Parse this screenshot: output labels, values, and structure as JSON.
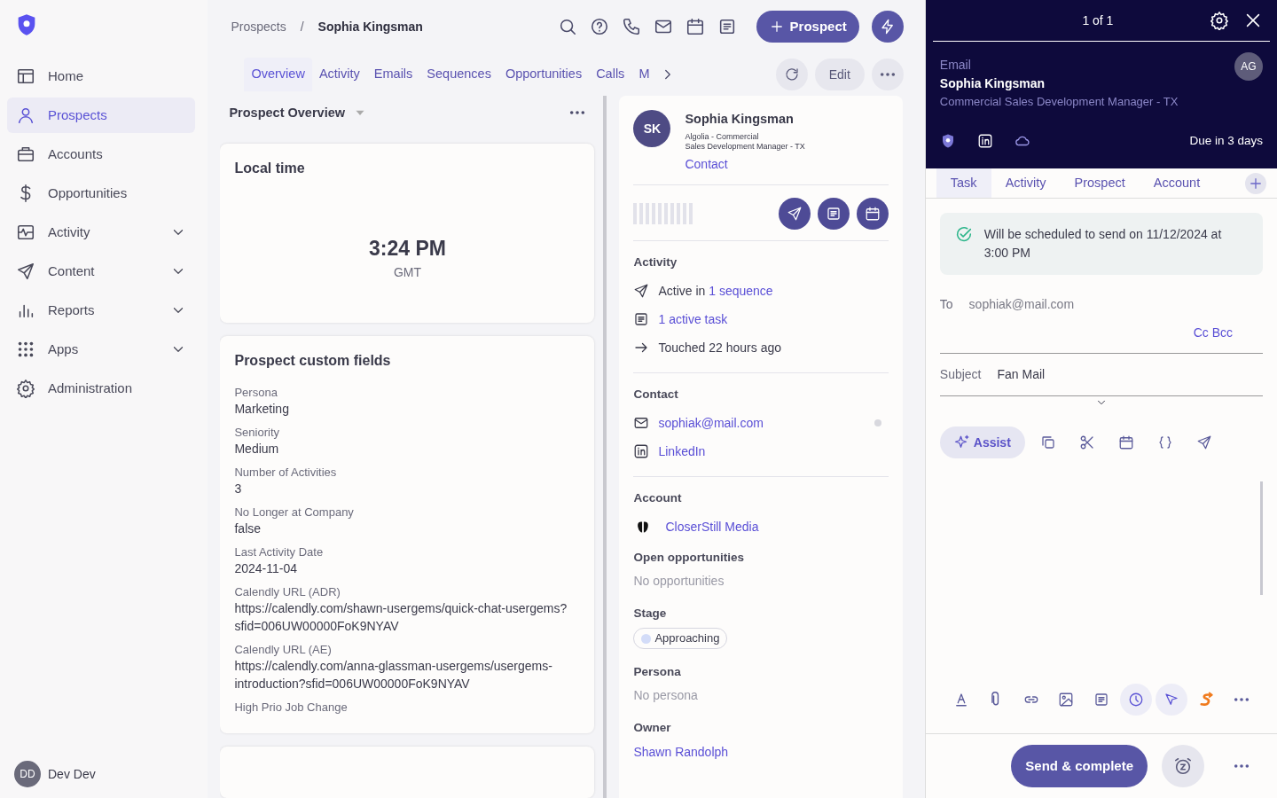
{
  "sidebar": {
    "items": [
      {
        "label": "Home",
        "kind": "link",
        "selected": false
      },
      {
        "label": "Prospects",
        "kind": "link",
        "selected": true
      },
      {
        "label": "Accounts",
        "kind": "link",
        "selected": false
      },
      {
        "label": "Opportunities",
        "kind": "link",
        "selected": false
      },
      {
        "label": "Activity",
        "kind": "group",
        "selected": false
      },
      {
        "label": "Content",
        "kind": "group",
        "selected": false
      },
      {
        "label": "Reports",
        "kind": "group",
        "selected": false
      },
      {
        "label": "Apps",
        "kind": "group",
        "selected": false
      },
      {
        "label": "Administration",
        "kind": "link",
        "selected": false
      }
    ],
    "user": {
      "initials": "DD",
      "name": "Dev Dev"
    }
  },
  "breadcrumb": {
    "parent": "Prospects",
    "separator": "/",
    "current": "Sophia Kingsman"
  },
  "new_button": {
    "label": "Prospect"
  },
  "tabs": [
    {
      "label": "Overview",
      "selected": true
    },
    {
      "label": "Activity",
      "selected": false
    },
    {
      "label": "Emails",
      "selected": false
    },
    {
      "label": "Sequences",
      "selected": false
    },
    {
      "label": "Opportunities",
      "selected": false
    },
    {
      "label": "Calls",
      "selected": false
    },
    {
      "label": "M",
      "selected": false
    }
  ],
  "edit_button": {
    "label": "Edit"
  },
  "overview": {
    "title": "Prospect Overview",
    "local_time": {
      "title": "Local time",
      "time": "3:24 PM",
      "zone": "GMT"
    },
    "custom_fields": {
      "title": "Prospect custom fields",
      "fields": [
        {
          "label": "Persona",
          "value": "Marketing"
        },
        {
          "label": "Seniority",
          "value": "Medium"
        },
        {
          "label": "Number of Activities",
          "value": "3"
        },
        {
          "label": "No Longer at Company",
          "value": "false"
        },
        {
          "label": "Last Activity Date",
          "value": "2024-11-04"
        },
        {
          "label": "Calendly URL (ADR)",
          "value": "https://calendly.com/shawn-usergems/quick-chat-usergems?sfid=006UW00000FoK9NYAV"
        },
        {
          "label": "Calendly URL (AE)",
          "value": "https://calendly.com/anna-glassman-usergems/usergems-introduction?sfid=006UW00000FoK9NYAV"
        },
        {
          "label": "High Prio Job Change"
        }
      ]
    }
  },
  "profile": {
    "initials": "SK",
    "name": "Sophia Kingsman",
    "company": "Algolia - Commercial",
    "title": "Sales Development Manager - TX",
    "contact_link": "Contact",
    "activity": {
      "title": "Activity",
      "sequence_prefix": "Active in",
      "sequence_link": "1 sequence",
      "task_link": "1 active task",
      "touched": "Touched 22 hours ago"
    },
    "contact": {
      "title": "Contact",
      "email": "sophiak@mail.com",
      "linkedin": "LinkedIn"
    },
    "account": {
      "title": "Account",
      "name": "CloserStill Media"
    },
    "opportunities": {
      "title": "Open opportunities",
      "empty": "No opportunities"
    },
    "stage": {
      "title": "Stage",
      "value": "Approaching",
      "color": "#d3dcf8"
    },
    "persona": {
      "title": "Persona",
      "empty": "No persona"
    },
    "owner": {
      "title": "Owner",
      "name": "Shawn Randolph"
    }
  },
  "task_panel": {
    "counter": "1 of 1",
    "type": "Email",
    "name": "Sophia Kingsman",
    "subtitle": "Commercial Sales Development Manager - TX",
    "avatar": "AG",
    "due": "Due in 3 days",
    "tabs": [
      {
        "label": "Task",
        "selected": true
      },
      {
        "label": "Activity",
        "selected": false
      },
      {
        "label": "Prospect",
        "selected": false
      },
      {
        "label": "Account",
        "selected": false
      }
    ],
    "notice": "Will be scheduled to send on 11/12/2024 at 3:00 PM",
    "to_label": "To",
    "to": "sophiak@mail.com",
    "cc_bcc": "Cc Bcc",
    "subject_label": "Subject",
    "subject": "Fan Mail",
    "assist": "Assist",
    "bottom_toggles": [
      {
        "selected": true
      },
      {
        "selected": true
      }
    ],
    "send_button": "Send & complete"
  }
}
